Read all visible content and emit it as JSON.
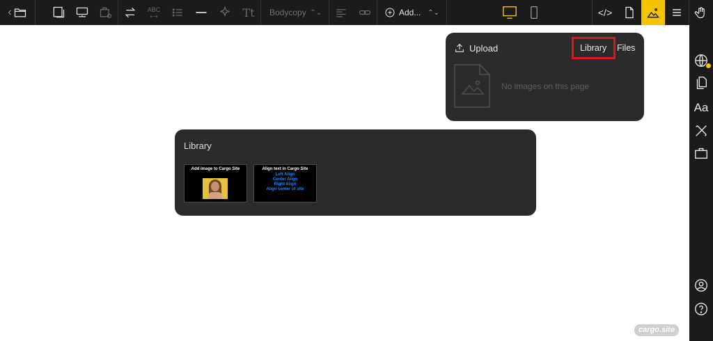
{
  "toolbar": {
    "back_glyph": "‹",
    "spellcheck_label": "ABC",
    "text_style_glyph": "Tt",
    "style_select_value": "Bodycopy",
    "add_label": "Add...",
    "code_label": "</>",
    "accent_color": "#f5c400"
  },
  "sidebar": {
    "typography_label": "Aa"
  },
  "images_panel": {
    "upload_label": "Upload",
    "tab_library": "Library",
    "tab_files": "Files",
    "empty_text": "No images on this page",
    "highlight_color": "#e0141b"
  },
  "library_panel": {
    "title": "Library",
    "thumbnails": [
      {
        "title": "Add image to Cargo Site",
        "lines": []
      },
      {
        "title": "Align text in Cargo Site",
        "lines": [
          "Left Align",
          "Center Align",
          "Right Align",
          "Align center of site"
        ]
      }
    ]
  },
  "watermark": "cargo.site"
}
